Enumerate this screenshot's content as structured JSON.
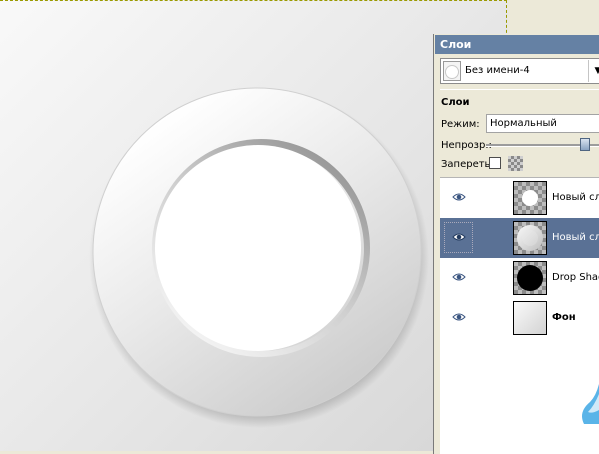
{
  "dialog": {
    "title": "Слои",
    "image_selector": {
      "value": "Без имени-4"
    },
    "section_label": "Слои",
    "mode_label": "Режим:",
    "mode_value": "Нормальный",
    "opacity_label": "Непрозр.:",
    "opacity_value": 0.87,
    "lock_label": "Запереть:"
  },
  "layers": [
    {
      "name": "Новый слой",
      "visible": true,
      "selected": false,
      "bold": false
    },
    {
      "name": "Новый слой",
      "visible": true,
      "selected": true,
      "bold": false
    },
    {
      "name": "Drop Shadow",
      "visible": true,
      "selected": false,
      "bold": false
    },
    {
      "name": "Фон",
      "visible": true,
      "selected": false,
      "bold": true
    }
  ],
  "colors": {
    "titlebar": "#6581a4",
    "selected_row": "#5a7195",
    "panel_bg": "#ece9d8",
    "accent_logo": "#5ab4e8"
  }
}
